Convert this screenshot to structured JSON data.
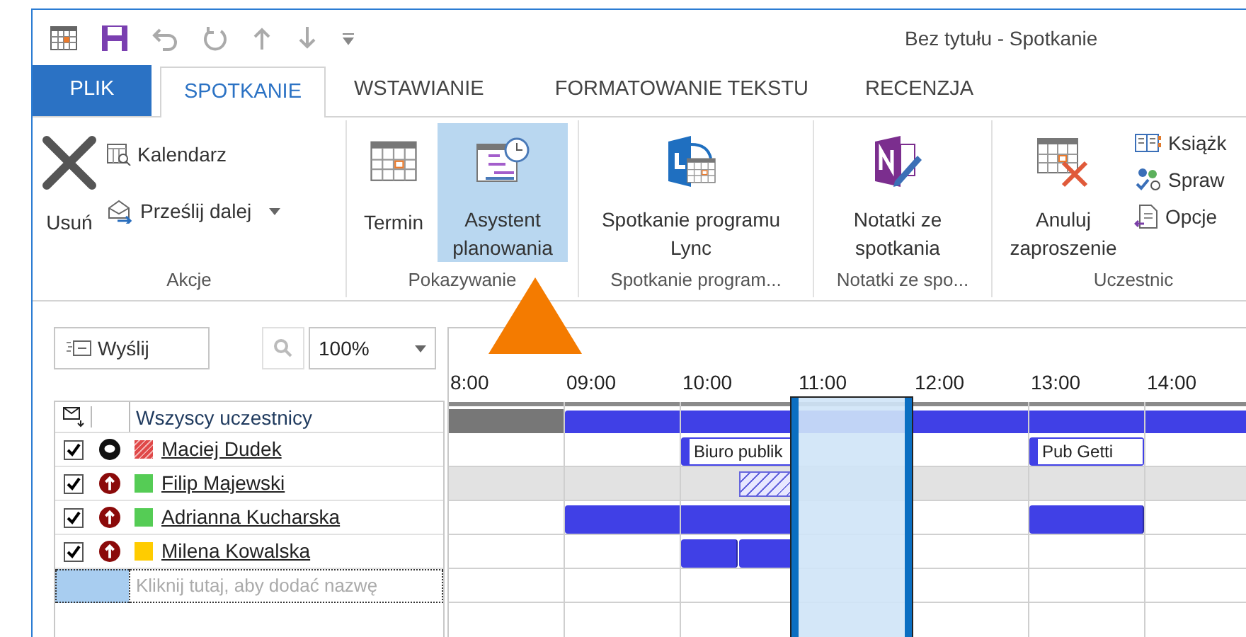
{
  "window": {
    "title": "Bez tytułu - Spotkanie"
  },
  "tabs": [
    {
      "label": "PLIK",
      "kind": "file",
      "selected": false
    },
    {
      "label": "SPOTKANIE",
      "kind": "tab",
      "selected": true
    },
    {
      "label": "WSTAWIANIE",
      "kind": "tab",
      "selected": false
    },
    {
      "label": "FORMATOWANIE TEKSTU",
      "kind": "tab",
      "selected": false
    },
    {
      "label": "RECENZJA",
      "kind": "tab",
      "selected": false
    }
  ],
  "ribbon": {
    "groups": [
      {
        "label": "Akcje",
        "items": [
          {
            "kind": "large",
            "label": "Usuń",
            "selected": false
          },
          {
            "kind": "small",
            "label": "Kalendarz"
          },
          {
            "kind": "dropdown",
            "label": "Prześlij dalej"
          }
        ]
      },
      {
        "label": "Pokazywanie",
        "items": [
          {
            "kind": "large",
            "label": "Termin",
            "selected": false
          },
          {
            "kind": "large",
            "label": "Asystent planowania",
            "selected": true
          }
        ]
      },
      {
        "label": "Spotkanie program...",
        "items": [
          {
            "kind": "large",
            "label": "Spotkanie programu Lync",
            "selected": false
          }
        ]
      },
      {
        "label": "Notatki ze spo...",
        "items": [
          {
            "kind": "large",
            "label": "Notatki ze spotkania",
            "selected": false
          }
        ]
      },
      {
        "label": "Uczestnic",
        "items": [
          {
            "kind": "large",
            "label": "Anuluj zaproszenie",
            "selected": false
          },
          {
            "kind": "small",
            "label": "Książk"
          },
          {
            "kind": "small",
            "label": "Spraw"
          },
          {
            "kind": "small",
            "label": "Opcje"
          }
        ]
      }
    ]
  },
  "toolbar": {
    "send": "Wyślij",
    "zoom": "100%"
  },
  "attendees_header": "Wszyscy uczestnicy",
  "timeline": {
    "hours": [
      {
        "label": "8:00",
        "selected": false
      },
      {
        "label": "09:00",
        "selected": false
      },
      {
        "label": "10:00",
        "selected": false
      },
      {
        "label": "11:00",
        "selected": true
      },
      {
        "label": "12:00",
        "selected": false
      },
      {
        "label": "13:00",
        "selected": false
      },
      {
        "label": "14:00",
        "selected": false
      }
    ],
    "all_slots": [
      {
        "kind": "unavailable"
      },
      {
        "kind": "cont"
      },
      {
        "kind": "busy"
      },
      {
        "kind": "cont"
      },
      {
        "kind": "cont"
      },
      {
        "kind": "cont"
      },
      {
        "kind": "cont"
      },
      {
        "kind": "cont"
      },
      {
        "kind": "cont"
      },
      {
        "kind": "cont"
      },
      {
        "kind": "cont"
      },
      {
        "kind": "cont"
      },
      {
        "kind": "cont"
      },
      {
        "kind": "cont"
      }
    ]
  },
  "attendees": [
    {
      "name": "Maciej Dudek",
      "checked": true,
      "kind": "organizer",
      "color": "#e04848",
      "hatched": true,
      "shaded": false,
      "slots": [
        {
          "kind": "free"
        },
        {
          "kind": "free"
        },
        {
          "kind": "free"
        },
        {
          "kind": "free"
        },
        {
          "kind": "busy",
          "label": "Biuro publik"
        },
        {
          "kind": "cont"
        },
        {
          "kind": "free"
        },
        {
          "kind": "free"
        },
        {
          "kind": "free"
        },
        {
          "kind": "free"
        },
        {
          "kind": "busy",
          "label": "Pub Getti"
        },
        {
          "kind": "cont"
        },
        {
          "kind": "free"
        },
        {
          "kind": "free"
        }
      ]
    },
    {
      "name": "Filip Majewski",
      "checked": true,
      "kind": "required",
      "color": "#55cc55",
      "hatched": false,
      "shaded": true,
      "slots": [
        {
          "kind": "free"
        },
        {
          "kind": "free"
        },
        {
          "kind": "free"
        },
        {
          "kind": "free"
        },
        {
          "kind": "free"
        },
        {
          "kind": "tentative"
        },
        {
          "kind": "free"
        },
        {
          "kind": "free"
        },
        {
          "kind": "free"
        },
        {
          "kind": "free"
        },
        {
          "kind": "free"
        },
        {
          "kind": "free"
        },
        {
          "kind": "free"
        },
        {
          "kind": "free"
        }
      ]
    },
    {
      "name": "Adrianna Kucharska",
      "checked": true,
      "kind": "required",
      "color": "#55cc55",
      "hatched": false,
      "shaded": false,
      "slots": [
        {
          "kind": "free"
        },
        {
          "kind": "free"
        },
        {
          "kind": "busy"
        },
        {
          "kind": "cont"
        },
        {
          "kind": "cont"
        },
        {
          "kind": "cont"
        },
        {
          "kind": "free"
        },
        {
          "kind": "free"
        },
        {
          "kind": "free"
        },
        {
          "kind": "free"
        },
        {
          "kind": "busy"
        },
        {
          "kind": "cont"
        },
        {
          "kind": "free"
        },
        {
          "kind": "free"
        }
      ]
    },
    {
      "name": "Milena Kowalska",
      "checked": true,
      "kind": "required",
      "color": "#ffcc00",
      "hatched": false,
      "shaded": false,
      "slots": [
        {
          "kind": "free"
        },
        {
          "kind": "free"
        },
        {
          "kind": "free"
        },
        {
          "kind": "free"
        },
        {
          "kind": "busy"
        },
        {
          "kind": "busy"
        },
        {
          "kind": "free"
        },
        {
          "kind": "free"
        },
        {
          "kind": "free"
        },
        {
          "kind": "free"
        },
        {
          "kind": "free"
        },
        {
          "kind": "free"
        },
        {
          "kind": "free"
        },
        {
          "kind": "free"
        }
      ]
    }
  ],
  "add_row": {
    "placeholder": "Kliknij tutaj, aby dodać nazwę"
  }
}
